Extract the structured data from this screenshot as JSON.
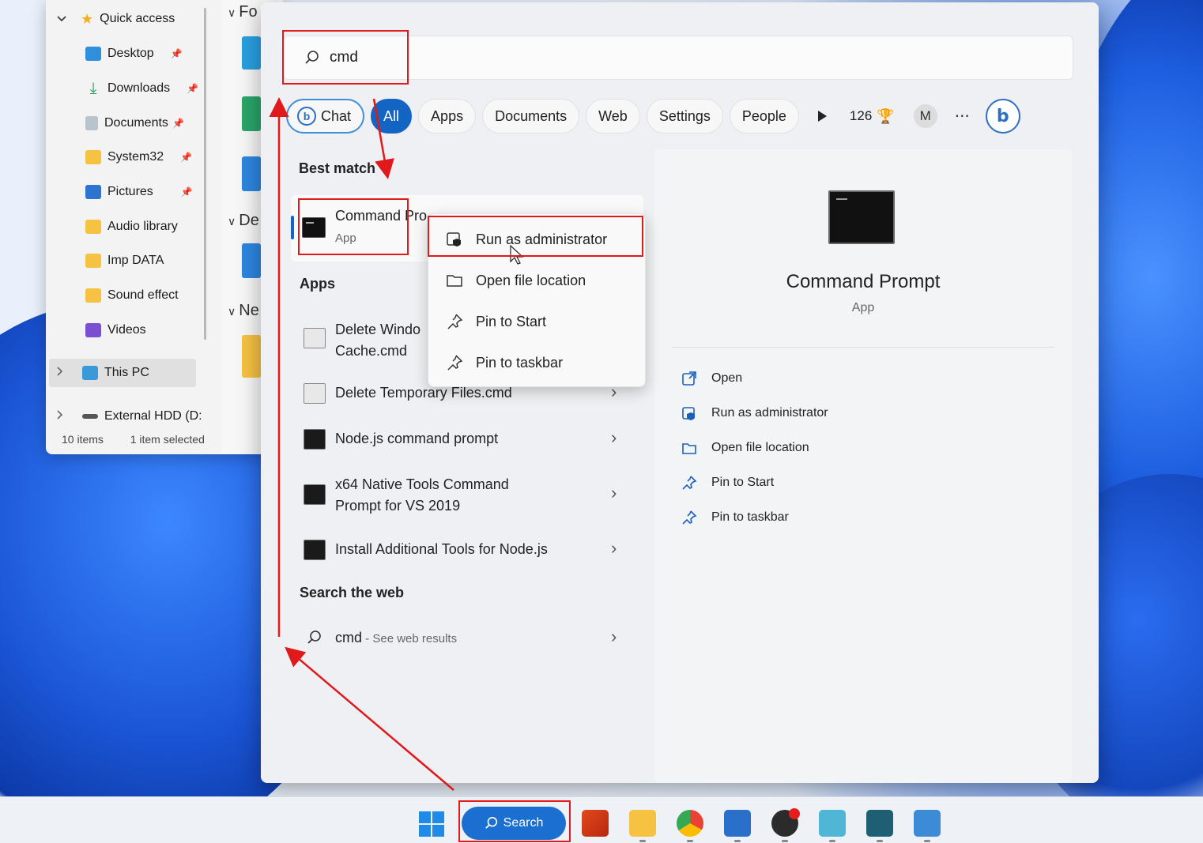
{
  "explorer": {
    "nav": [
      {
        "label": "Quick access",
        "icon": "star-icon",
        "color": "#f2b01e"
      },
      {
        "label": "Desktop",
        "icon": "desktop-icon",
        "color": "#2f8fdd",
        "pinned": true
      },
      {
        "label": "Downloads",
        "icon": "download-icon",
        "color": "#2a9d5c",
        "pinned": true
      },
      {
        "label": "Documents",
        "icon": "documents-icon",
        "color": "#8a9aa8",
        "pinned": true
      },
      {
        "label": "System32",
        "icon": "folder-icon",
        "color": "#f5c242",
        "pinned": true
      },
      {
        "label": "Pictures",
        "icon": "pictures-icon",
        "color": "#2b74cf",
        "pinned": true
      },
      {
        "label": "Audio library",
        "icon": "folder-icon",
        "color": "#f5c242"
      },
      {
        "label": "Imp DATA",
        "icon": "folder-icon",
        "color": "#f5c242"
      },
      {
        "label": "Sound effect",
        "icon": "folder-icon",
        "color": "#f5c242"
      },
      {
        "label": "Videos",
        "icon": "videos-icon",
        "color": "#7b4fd1"
      },
      {
        "label": "This PC",
        "icon": "pc-icon",
        "color": "#3a9ad9"
      },
      {
        "label": "External HDD (D:",
        "icon": "drive-icon",
        "color": "#555555"
      }
    ],
    "status_items": "10 items",
    "status_selected": "1 item selected",
    "content_labels": [
      "Fo",
      "De",
      "Ne"
    ]
  },
  "search": {
    "query": "cmd",
    "filters": {
      "chat": "Chat",
      "all": "All",
      "apps": "Apps",
      "documents": "Documents",
      "web": "Web",
      "settings": "Settings",
      "people": "People"
    },
    "points": "126",
    "avatar_initial": "M",
    "more": "···",
    "best_match_heading": "Best match",
    "best_match": {
      "title": "Command Pro",
      "subtitle": "App"
    },
    "apps_heading": "Apps",
    "apps": [
      {
        "line1": "Delete Windo",
        "line2": "Cache.cmd"
      },
      {
        "line1": "Delete Temporary Files.cmd"
      },
      {
        "line1": "Node.js command prompt"
      },
      {
        "line1": "x64 Native Tools Command",
        "line2": "Prompt for VS 2019"
      },
      {
        "line1": "Install Additional Tools for Node.js"
      }
    ],
    "web_heading": "Search the web",
    "web_result": {
      "query": "cmd",
      "suffix": " - See web results"
    },
    "context_menu": [
      "Run as administrator",
      "Open file location",
      "Pin to Start",
      "Pin to taskbar"
    ],
    "preview": {
      "title": "Command Prompt",
      "subtitle": "App",
      "actions": [
        "Open",
        "Run as administrator",
        "Open file location",
        "Pin to Start",
        "Pin to taskbar"
      ]
    }
  },
  "taskbar": {
    "search_label": "Search"
  },
  "colors": {
    "accent": "#1465c3",
    "annotation": "#e0191b"
  }
}
